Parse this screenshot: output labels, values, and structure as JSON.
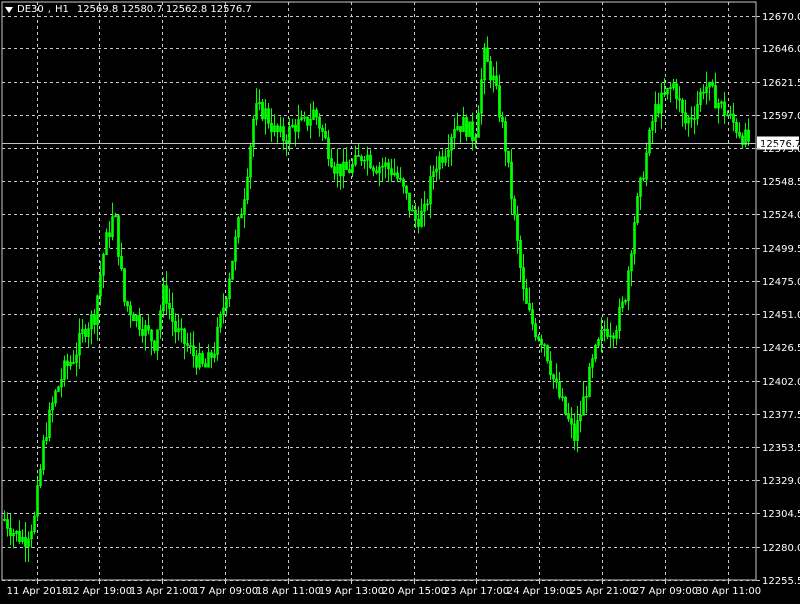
{
  "header": {
    "symbol": "DE30",
    "timeframe": "H1",
    "ohlc": "12569.8 12580.7 12562.8 12576.7",
    "menu_icon": "triangle-down-icon"
  },
  "colors": {
    "background": "#000000",
    "grid": "#c8c8c8",
    "candle": "#00ff00",
    "axis_text": "#ffffff",
    "price_line": "#c0c0c0",
    "price_label_bg": "#ffffff",
    "price_label_text": "#000000"
  },
  "chart_data": {
    "type": "line",
    "style": "candlestick",
    "title": "DE30,H1  12569.8 12580.7 12562.8 12576.7",
    "xlabel": "",
    "ylabel": "",
    "grid": true,
    "ylim": [
      12255.5,
      12680
    ],
    "y_ticks": [
      "12670.0",
      "12646.0",
      "12621.5",
      "12597.0",
      "12573.0",
      "12548.5",
      "12524.0",
      "12499.5",
      "12475.0",
      "12451.0",
      "12426.5",
      "12402.0",
      "12377.5",
      "12353.5",
      "12329.0",
      "12304.5",
      "12280.0",
      "12255.5"
    ],
    "x_ticks": [
      "11 Apr 2018",
      "12 Apr 19:00",
      "13 Apr 21:00",
      "17 Apr 09:00",
      "18 Apr 11:00",
      "19 Apr 13:00",
      "20 Apr 15:00",
      "23 Apr 17:00",
      "24 Apr 19:00",
      "25 Apr 21:00",
      "27 Apr 09:00",
      "30 Apr 11:00"
    ],
    "current_price": "12576.7",
    "series": [
      {
        "x": [
          0,
          10,
          20,
          30,
          40,
          50,
          60,
          70,
          80,
          90,
          100,
          110,
          120,
          130,
          140,
          150,
          160,
          170,
          180,
          190,
          200,
          210,
          220,
          230,
          240,
          250,
          260,
          270,
          280,
          290,
          300,
          310,
          320,
          330,
          340,
          350,
          360,
          370,
          380,
          390,
          400,
          410,
          420,
          430,
          440,
          450,
          460,
          470,
          480,
          490,
          500,
          510,
          520,
          530,
          540,
          550,
          560,
          570,
          580,
          590,
          600,
          610,
          620,
          630,
          640,
          650,
          660,
          670,
          680,
          690,
          700,
          710,
          720,
          730,
          740,
          746
        ],
        "values": [
          12300,
          12290,
          12285,
          12300,
          12360,
          12390,
          12410,
          12420,
          12440,
          12450,
          12500,
          12525,
          12460,
          12450,
          12440,
          12430,
          12470,
          12440,
          12430,
          12420,
          12410,
          12425,
          12460,
          12500,
          12540,
          12600,
          12600,
          12585,
          12580,
          12590,
          12590,
          12600,
          12580,
          12560,
          12555,
          12560,
          12570,
          12560,
          12560,
          12555,
          12540,
          12520,
          12525,
          12560,
          12570,
          12590,
          12590,
          12580,
          12640,
          12620,
          12580,
          12520,
          12460,
          12440,
          12430,
          12400,
          12380,
          12360,
          12390,
          12420,
          12440,
          12440,
          12460,
          12520,
          12560,
          12600,
          12610,
          12620,
          12590,
          12600,
          12620,
          12610,
          12600,
          12590,
          12580,
          12577
        ]
      }
    ]
  }
}
